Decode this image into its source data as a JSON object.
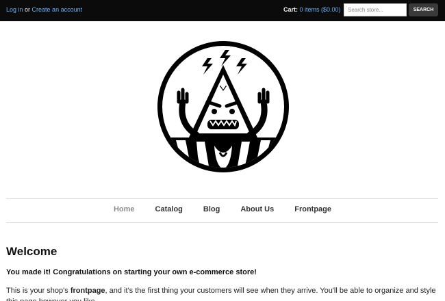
{
  "header": {
    "login_label": "Log in",
    "or_text": " or ",
    "create_account_label": "Create an account",
    "cart_label": "Cart:",
    "cart_summary": "0 items ($0.00)",
    "search_placeholder": "Search store...",
    "search_button": "SEARCH"
  },
  "logo": {
    "icon": "mountain-monster-logo"
  },
  "nav": {
    "items": [
      {
        "label": "Home",
        "active": true
      },
      {
        "label": "Catalog"
      },
      {
        "label": "Blog"
      },
      {
        "label": "About Us"
      },
      {
        "label": "Frontpage"
      }
    ]
  },
  "content": {
    "title": "Welcome",
    "lead": "You made it! Congratulations on starting your own e-commerce store!",
    "para_prefix": "This is your shop's ",
    "para_bold": "frontpage",
    "para_suffix": ", and it's the first thing your customers will see when they arrive. You'll be able to organize and style this page however you like."
  },
  "colors": {
    "topbar": "#0b0b0b",
    "link": "#6cb0f0",
    "nav_active": "#8c8c8c"
  }
}
